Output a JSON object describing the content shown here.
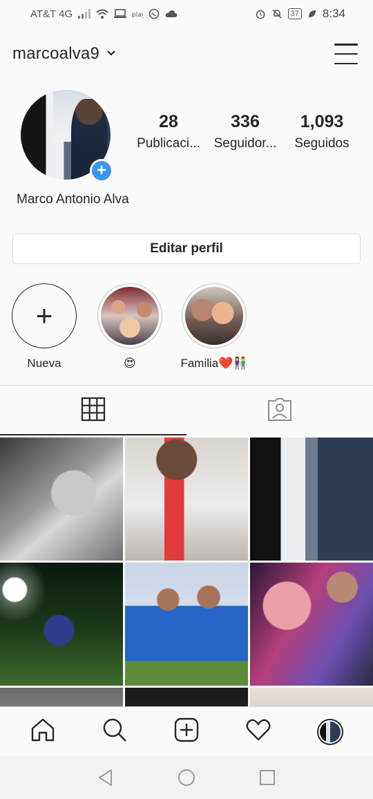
{
  "status_bar": {
    "carrier": "AT&T 4G",
    "battery": "37",
    "time": "8:34",
    "icons": [
      "signal-icon",
      "wifi-icon",
      "screen-icon",
      "play-icon",
      "whatsapp-icon",
      "cloud-icon",
      "alarm-icon",
      "mute-icon",
      "leaf-icon"
    ]
  },
  "header": {
    "username": "marcoalva9",
    "icons": [
      "chevron-down-icon",
      "menu-icon"
    ]
  },
  "profile": {
    "full_name": "Marco Antonio Alva",
    "stats": [
      {
        "value": "28",
        "label": "Publicaci..."
      },
      {
        "value": "336",
        "label": "Seguidor..."
      },
      {
        "value": "1,093",
        "label": "Seguidos"
      }
    ],
    "edit_button": "Editar perfil"
  },
  "highlights": [
    {
      "label": "Nueva"
    },
    {
      "label": "😍"
    },
    {
      "label": "Familia❤️👫"
    }
  ],
  "tabs": [
    {
      "icon": "grid-icon",
      "active": true
    },
    {
      "icon": "tagged-icon",
      "active": false
    }
  ],
  "bottom_nav": [
    "home-icon",
    "search-icon",
    "add-post-icon",
    "heart-icon",
    "profile-avatar"
  ],
  "android_nav": [
    "back-icon",
    "home-circle-icon",
    "recents-icon"
  ],
  "colors": {
    "accent": "#3897f0",
    "text": "#262626",
    "border": "#dbdbdb",
    "background": "#fafafa"
  }
}
